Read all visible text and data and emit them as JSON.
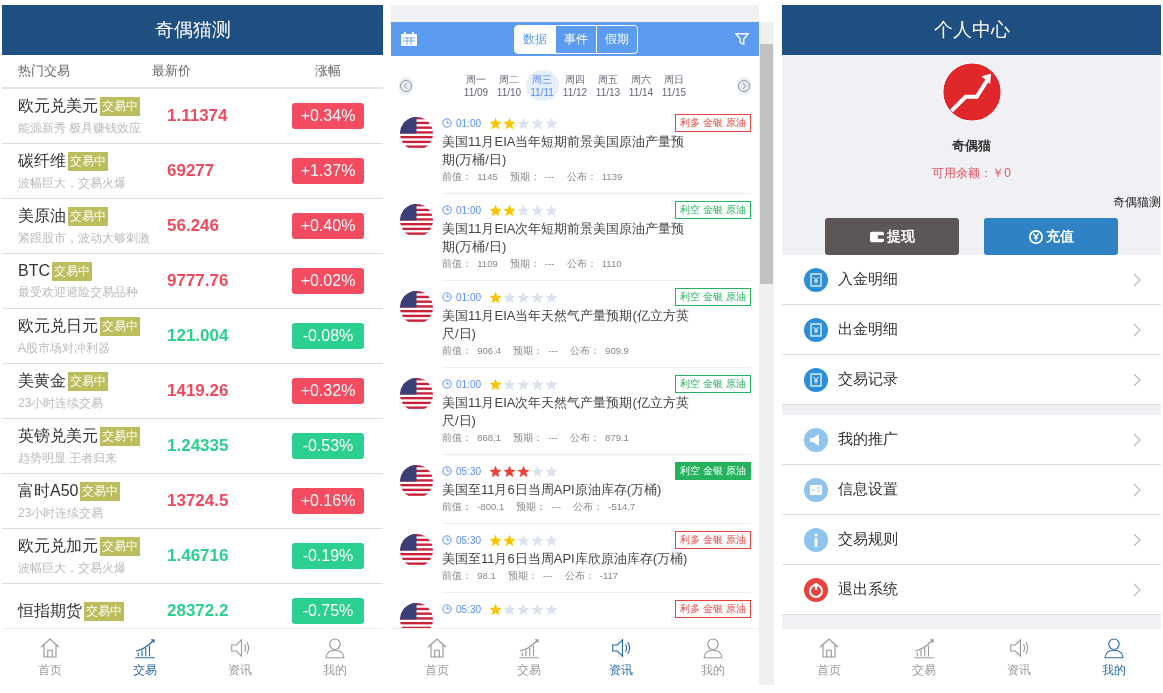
{
  "market": {
    "title": "奇偶猫测",
    "columns": [
      "热门交易",
      "最新价",
      "涨幅"
    ],
    "rows": [
      {
        "name": "欧元兑美元",
        "badge": "交易中",
        "subtitle": "能源新秀 极具赚钱效应",
        "price": "1.11374",
        "change": "+0.34%",
        "rising": true
      },
      {
        "name": "碳纤维",
        "badge": "交易中",
        "subtitle": "波幅巨大，交易火爆",
        "price": "69277",
        "change": "+1.37%",
        "rising": true
      },
      {
        "name": "美原油",
        "badge": "交易中",
        "subtitle": "紧跟股市，波动大够刺激",
        "price": "56.246",
        "change": "+0.40%",
        "rising": true
      },
      {
        "name": "BTC",
        "badge": "交易中",
        "subtitle": "最受欢迎避险交易品种",
        "price": "9777.76",
        "change": "+0.02%",
        "rising": true
      },
      {
        "name": "欧元兑日元",
        "badge": "交易中",
        "subtitle": "A股市场对冲利器",
        "price": "121.004",
        "change": "-0.08%",
        "rising": false
      },
      {
        "name": "美黄金",
        "badge": "交易中",
        "subtitle": "23小时连续交易",
        "price": "1419.26",
        "change": "+0.32%",
        "rising": true
      },
      {
        "name": "英镑兑美元",
        "badge": "交易中",
        "subtitle": "趋势明显 王者归来",
        "price": "1.24335",
        "change": "-0.53%",
        "rising": false
      },
      {
        "name": "富时A50",
        "badge": "交易中",
        "subtitle": "23小时连续交易",
        "price": "13724.5",
        "change": "+0.16%",
        "rising": true
      },
      {
        "name": "欧元兑加元",
        "badge": "交易中",
        "subtitle": "波幅巨大，交易火爆",
        "price": "1.46716",
        "change": "-0.19%",
        "rising": false
      },
      {
        "name": "恒指期货",
        "badge": "交易中",
        "price": "28372.2",
        "change": "-0.75%",
        "rising": false
      }
    ],
    "tab_bar": [
      {
        "label": "首页",
        "kind": "home",
        "selected": false
      },
      {
        "label": "交易",
        "kind": "chart",
        "selected": true
      },
      {
        "label": "资讯",
        "kind": "speaker",
        "selected": false
      },
      {
        "label": "我的",
        "kind": "person",
        "selected": false
      }
    ]
  },
  "calendar": {
    "segments": [
      {
        "label": "数据",
        "selected": true
      },
      {
        "label": "事件",
        "selected": false
      },
      {
        "label": "假期",
        "selected": false
      }
    ],
    "days": [
      {
        "weekday": "周一",
        "date": "11/09",
        "selected": false
      },
      {
        "weekday": "周二",
        "date": "11/10",
        "selected": false
      },
      {
        "weekday": "周三",
        "date": "11/11",
        "selected": true
      },
      {
        "weekday": "周四",
        "date": "11/12",
        "selected": false
      },
      {
        "weekday": "周五",
        "date": "11/13",
        "selected": false
      },
      {
        "weekday": "周六",
        "date": "11/14",
        "selected": false
      },
      {
        "weekday": "周日",
        "date": "11/15",
        "selected": false
      }
    ],
    "events": [
      {
        "time": "01:00",
        "stars": 2,
        "tag": "利多 金银 原油",
        "bullish": true,
        "highlighted": false,
        "title": "美国11月EIA当年短期前景美国原油产量预期(万桶/日)",
        "previous": "前值：  1145",
        "forecast": "预期：  ---",
        "actual": "公布：  1139"
      },
      {
        "time": "01:00",
        "stars": 2,
        "tag": "利空 金银 原油",
        "bullish": false,
        "highlighted": false,
        "title": "美国11月EIA次年短期前景美国原油产量预期(万桶/日)",
        "previous": "前值：  1109",
        "forecast": "预期：  ---",
        "actual": "公布：  1110"
      },
      {
        "time": "01:00",
        "stars": 1,
        "tag": "利空 金银 原油",
        "bullish": false,
        "highlighted": false,
        "title": "美国11月EIA当年天然气产量预期(亿立方英尺/日)",
        "previous": "前值：  906.4",
        "forecast": "预期：  ---",
        "actual": "公布：  909.9"
      },
      {
        "time": "01:00",
        "stars": 1,
        "tag": "利空 金银 原油",
        "bullish": false,
        "highlighted": false,
        "title": "美国11月EIA次年天然气产量预期(亿立方英尺/日)",
        "previous": "前值：  868.1",
        "forecast": "预期：  ---",
        "actual": "公布：  879.1"
      },
      {
        "time": "05:30",
        "stars": 3,
        "tag": "利空 金银 原油",
        "bullish": false,
        "highlighted": true,
        "title": "美国至11月6日当周API原油库存(万桶)",
        "previous": "前值：  -800.1",
        "forecast": "预期：  ---",
        "actual": "公布：  -514.7"
      },
      {
        "time": "05:30",
        "stars": 2,
        "tag": "利多 金银 原油",
        "bullish": true,
        "highlighted": false,
        "title": "美国至11月6日当周API库欣原油库存(万桶)",
        "previous": "前值：  98.1",
        "forecast": "预期：  ---",
        "actual": "公布：  -117"
      },
      {
        "time": "05:30",
        "stars": 1,
        "tag": "利多 金银 原油",
        "bullish": true,
        "highlighted": false
      }
    ],
    "tab_bar": [
      {
        "label": "首页",
        "kind": "home",
        "selected": false
      },
      {
        "label": "交易",
        "kind": "chart",
        "selected": false
      },
      {
        "label": "资讯",
        "kind": "speaker",
        "selected": true
      },
      {
        "label": "我的",
        "kind": "person",
        "selected": false
      }
    ]
  },
  "profile": {
    "title": "个人中心",
    "username": "奇偶猫",
    "balance": "可用余额：￥0",
    "note": "奇偶猫测",
    "buttons": [
      {
        "label": "提现",
        "kind": "withdraw"
      },
      {
        "label": "充值",
        "kind": "recharge"
      }
    ],
    "menu_groups": [
      [
        {
          "label": "入金明细",
          "kind": "deposit"
        },
        {
          "label": "出金明细",
          "kind": "withdrawal"
        },
        {
          "label": "交易记录",
          "kind": "records"
        }
      ],
      [
        {
          "label": "我的推广",
          "kind": "promote"
        },
        {
          "label": "信息设置",
          "kind": "settings"
        },
        {
          "label": "交易规则",
          "kind": "info"
        },
        {
          "label": "退出系统",
          "kind": "logout"
        }
      ]
    ],
    "tab_bar": [
      {
        "label": "首页",
        "kind": "home",
        "selected": false
      },
      {
        "label": "交易",
        "kind": "chart",
        "selected": false
      },
      {
        "label": "资讯",
        "kind": "speaker",
        "selected": false
      },
      {
        "label": "我的",
        "kind": "person",
        "selected": true
      }
    ]
  }
}
